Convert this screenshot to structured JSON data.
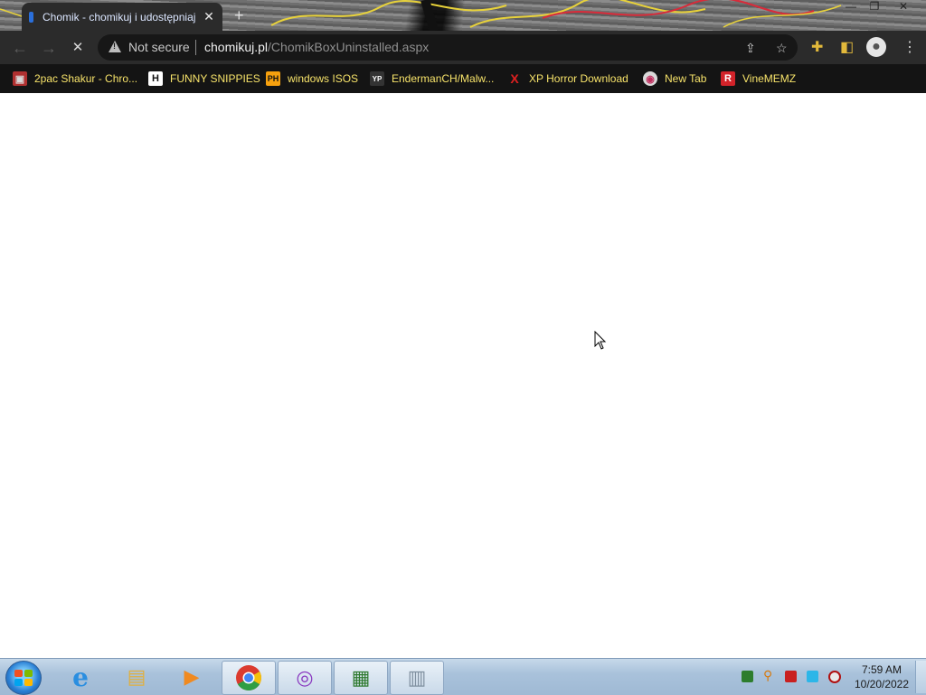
{
  "browser": {
    "tab_title": "Chomik - chomikuj i udostępniaj",
    "tab_close": "✕",
    "new_tab": "+",
    "window_controls": {
      "minimize": "—",
      "maximize": "❐",
      "close": "✕"
    },
    "security_label": "Not secure",
    "url_host": "chomikuj.pl",
    "url_path": "/ChomikBoxUninstalled.aspx",
    "loading": true
  },
  "bookmarks": [
    {
      "label": "2pac Shakur - Chro...",
      "icon": "photo-icon",
      "glyph": "▣",
      "icon_color": "#d9d9d9",
      "icon_bg": "#b03030"
    },
    {
      "label": "FUNNY SNIPPIES",
      "icon": "h-logo-icon",
      "glyph": "H",
      "icon_color": "#111111",
      "icon_bg": "#ffffff"
    },
    {
      "label": "windows ISOS",
      "icon": "ph-logo-icon",
      "glyph": "PH",
      "icon_color": "#111111",
      "icon_bg": "#f7a10e"
    },
    {
      "label": "EndermanCH/Malw...",
      "icon": "yp-logo-icon",
      "glyph": "YP",
      "icon_color": "#ffffff",
      "icon_bg": "#333333"
    },
    {
      "label": "XP Horror Download",
      "icon": "x-logo-icon",
      "glyph": "X",
      "icon_color": "#e02020",
      "icon_bg": "#141414"
    },
    {
      "label": "New Tab",
      "icon": "globe-icon",
      "glyph": "◉",
      "icon_color": "#c03060",
      "icon_bg": "#d9d9d9"
    },
    {
      "label": "VineMEMZ",
      "icon": "r-logo-icon",
      "glyph": "R",
      "icon_color": "#ffffff",
      "icon_bg": "#d2232a"
    }
  ],
  "taskbar": {
    "pinned": [
      {
        "name": "internet-explorer-icon",
        "glyph": "e",
        "color": "#2a8ee0",
        "active": false
      },
      {
        "name": "file-explorer-icon",
        "glyph": "▤",
        "color": "#e0b040",
        "active": false
      },
      {
        "name": "media-player-icon",
        "glyph": "▶",
        "color": "#f08a20",
        "active": false
      },
      {
        "name": "chrome-icon",
        "glyph": "◉",
        "color": "#db3b2f",
        "active": true
      },
      {
        "name": "app-icon",
        "glyph": "◎",
        "color": "#8a3ac0",
        "active": true
      },
      {
        "name": "task-manager-icon",
        "glyph": "▦",
        "color": "#2f7a2f",
        "active": true
      },
      {
        "name": "program-icon",
        "glyph": "▥",
        "color": "#7f8f9f",
        "active": true
      }
    ],
    "clock_time": "7:59 AM",
    "clock_date": "10/20/2022"
  }
}
